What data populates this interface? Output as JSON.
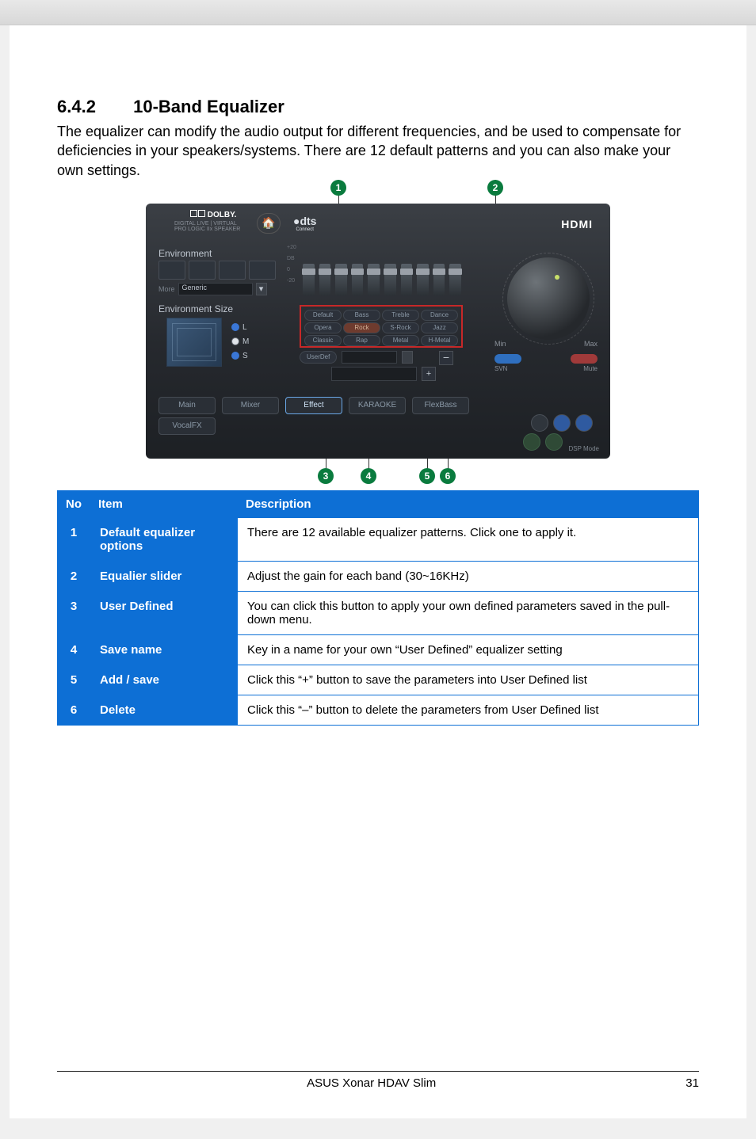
{
  "section": {
    "number": "6.4.2",
    "title": "10-Band Equalizer"
  },
  "intro": "The equalizer can modify the audio output for different frequencies, and be used to compensate for deficiencies in your speakers/systems. There are 12 default patterns and you can also make your own settings.",
  "ui": {
    "dolby_label": "DOLBY.",
    "dolby_sub1": "DIGITAL LIVE",
    "dolby_sub2": "VIRTUAL",
    "dolby_sub3": "PRO LOGIC IIx   SPEAKER",
    "dts_label": "dts",
    "dts_sub": "Connect",
    "hdmi": "HDMI",
    "env_label": "Environment",
    "more_label": "More",
    "env_selected": "Generic",
    "size_label": "Environment Size",
    "size_options": {
      "l": "L",
      "m": "M",
      "s": "S"
    },
    "eq_scale": {
      "top": "+20",
      "db1": "DB",
      "mid": "0",
      "db2": "DB",
      "low": "-20",
      "db3": "DB"
    },
    "presets": [
      "Default",
      "Bass",
      "Treble",
      "Dance",
      "Opera",
      "Rock",
      "S-Rock",
      "Jazz",
      "Classic",
      "Rap",
      "Metal",
      "H-Metal"
    ],
    "userdef_btn": "UserDef",
    "tabs": {
      "main": "Main",
      "mixer": "Mixer",
      "effect": "Effect",
      "karaoke": "KARAOKE",
      "flexbass": "FlexBass",
      "vocalfx": "VocalFX"
    },
    "min": "Min",
    "max": "Max",
    "svn": "SVN",
    "mute": "Mute",
    "dsp": "DSP Mode"
  },
  "callouts": [
    "1",
    "2",
    "3",
    "4",
    "5",
    "6"
  ],
  "table": {
    "headers": {
      "no": "No",
      "item": "Item",
      "desc": "Description"
    },
    "rows": [
      {
        "no": "1",
        "item": "Default equalizer options",
        "desc": "There are 12 available equalizer patterns. Click one to apply it."
      },
      {
        "no": "2",
        "item": "Equalier slider",
        "desc": "Adjust the gain for each band (30~16KHz)"
      },
      {
        "no": "3",
        "item": "User Defined",
        "desc": "You can click this button to apply your own defined parameters saved in the pull-down menu."
      },
      {
        "no": "4",
        "item": "Save name",
        "desc": "Key in a name for your own “User Defined” equalizer setting"
      },
      {
        "no": "5",
        "item": "Add / save",
        "desc": "Click this “+” button to save the parameters into User Defined list"
      },
      {
        "no": "6",
        "item": "Delete",
        "desc": "Click this “–” button to delete the parameters from User Defined list"
      }
    ]
  },
  "footer": {
    "product": "ASUS Xonar HDAV Slim",
    "page": "31"
  }
}
